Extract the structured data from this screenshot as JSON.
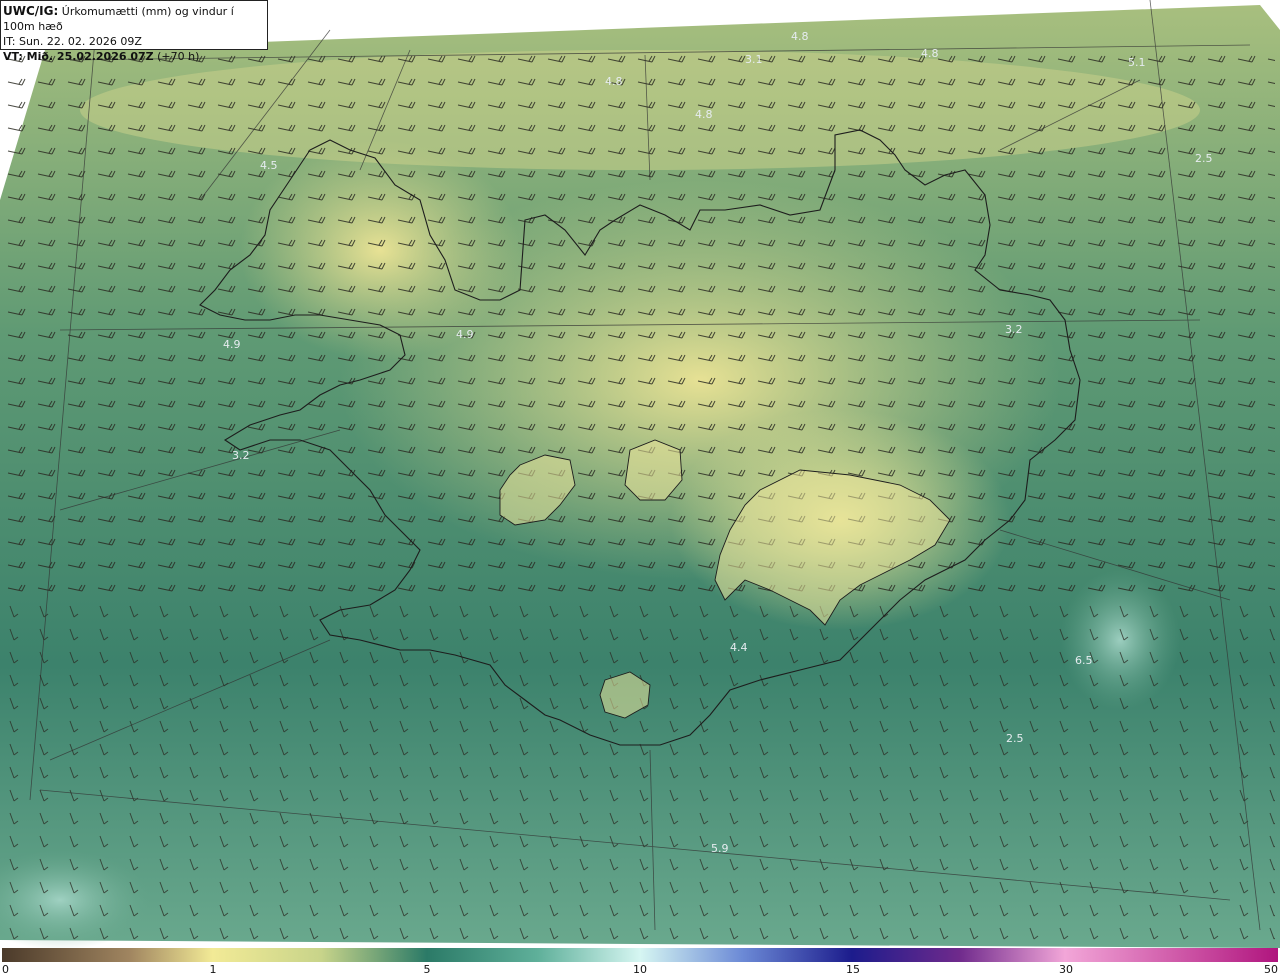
{
  "header": {
    "model_label": "UWC/IG:",
    "title": "Úrkomumætti (mm) og vindur í 100m hæð",
    "it_label": "IT: Sun. 22. 02. 2026 09Z",
    "vt_label": "VT: Mið. 25.02.2026 07Z",
    "lead": "(+70 h)"
  },
  "map_labels": [
    {
      "id": "l1",
      "text": "4.8"
    },
    {
      "id": "l2",
      "text": "3.1"
    },
    {
      "id": "l3",
      "text": "4.8"
    },
    {
      "id": "l4",
      "text": "4.8"
    },
    {
      "id": "l5",
      "text": "5.1"
    },
    {
      "id": "l6",
      "text": "4.8"
    },
    {
      "id": "l7",
      "text": "4.5"
    },
    {
      "id": "l8",
      "text": "2.5"
    },
    {
      "id": "l9",
      "text": "4.9"
    },
    {
      "id": "l10",
      "text": "4.9"
    },
    {
      "id": "l11",
      "text": "3.2"
    },
    {
      "id": "l12",
      "text": "3.2"
    },
    {
      "id": "l13",
      "text": "4.4"
    },
    {
      "id": "l14",
      "text": "6.5"
    },
    {
      "id": "l15",
      "text": "2.5"
    },
    {
      "id": "l16",
      "text": "5.9"
    }
  ],
  "colorbar": {
    "ticks": [
      "0",
      "1",
      "5",
      "10",
      "15",
      "30",
      "50"
    ],
    "colors": {
      "brown": "#4b3a2a",
      "tan": "#c2a56e",
      "yellow": "#f2ea96",
      "teal": "#2b7a67",
      "cyan": "#d6f6f2",
      "navy": "#1c1c8c",
      "purple": "#6f2a8c",
      "pink": "#f2a6d8",
      "magenta": "#b0157e"
    }
  }
}
